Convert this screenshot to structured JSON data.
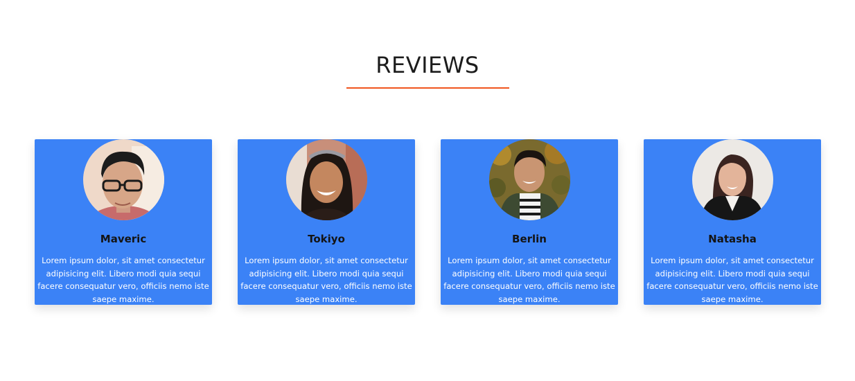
{
  "section": {
    "title": "REVIEWS",
    "accent_color": "#f0541e"
  },
  "card_color": "#3b82f6",
  "reviews": [
    {
      "name": "Maveric",
      "avatar_icon": "man-with-glasses-avatar",
      "text": "Lorem ipsum dolor, sit amet consectetur adipisicing elit. Libero modi quia sequi facere consequatur vero, officiis nemo iste saepe maxime."
    },
    {
      "name": "Tokiyo",
      "avatar_icon": "smiling-woman-avatar",
      "text": "Lorem ipsum dolor, sit amet consectetur adipisicing elit. Libero modi quia sequi facere consequatur vero, officiis nemo iste saepe maxime."
    },
    {
      "name": "Berlin",
      "avatar_icon": "man-in-jacket-avatar",
      "text": "Lorem ipsum dolor, sit amet consectetur adipisicing elit. Libero modi quia sequi facere consequatur vero, officiis nemo iste saepe maxime."
    },
    {
      "name": "Natasha",
      "avatar_icon": "woman-in-blazer-avatar",
      "text": "Lorem ipsum dolor, sit amet consectetur adipisicing elit. Libero modi quia sequi facere consequatur vero, officiis nemo iste saepe maxime."
    }
  ]
}
